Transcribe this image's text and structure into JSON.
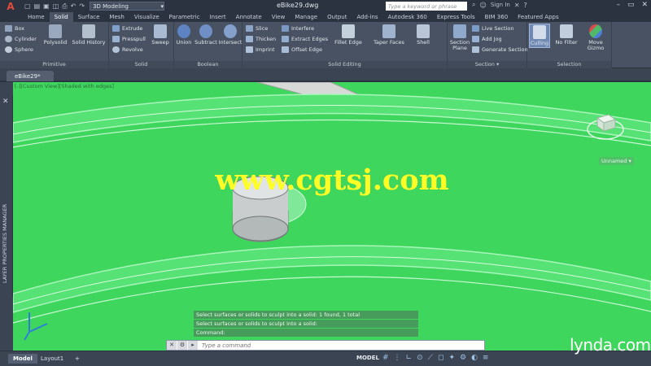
{
  "window": {
    "doc_title": "eBike29.dwg",
    "workspace": "3D Modeling",
    "search_placeholder": "Type a keyword or phrase",
    "sign_in": "Sign In"
  },
  "tabs": [
    "Home",
    "Solid",
    "Surface",
    "Mesh",
    "Visualize",
    "Parametric",
    "Insert",
    "Annotate",
    "View",
    "Manage",
    "Output",
    "Add-ins",
    "Autodesk 360",
    "Express Tools",
    "BIM 360",
    "Featured Apps"
  ],
  "ribbon": {
    "primitive": {
      "title": "Primitive",
      "box": "Box",
      "cylinder": "Cylinder",
      "sphere": "Sphere",
      "polysolid": "Polysolid",
      "solid_history": "Solid History"
    },
    "solid": {
      "title": "Solid",
      "extrude": "Extrude",
      "presspull": "Presspull",
      "revolve": "Revolve",
      "sweep": "Sweep"
    },
    "boolean": {
      "title": "Boolean",
      "union": "Union",
      "subtract": "Subtract",
      "intersect": "Intersect"
    },
    "solid_editing": {
      "title": "Solid Editing",
      "slice": "Slice",
      "thicken": "Thicken",
      "imprint": "Imprint",
      "interfere": "Interfere",
      "extract_edges": "Extract Edges",
      "offset_edge": "Offset Edge",
      "fillet_edge": "Fillet Edge",
      "taper_faces": "Taper Faces",
      "shell": "Shell"
    },
    "section": {
      "title": "Section",
      "section_plane": "Section Plane",
      "live_section": "Live Section",
      "add_jog": "Add Jog",
      "generate_section": "Generate Section"
    },
    "selection": {
      "title": "Selection",
      "culling": "Culling",
      "no_filter": "No Filter",
      "move_gizmo": "Move Gizmo"
    }
  },
  "file_tab": "eBike29*",
  "viewport": {
    "label": "[-][Custom View][Shaded with edges]",
    "watermark": "www.cgtsj.com",
    "unsaved": "Unnamed"
  },
  "palette": {
    "title": "LAYER PROPERTIES MANAGER"
  },
  "command": {
    "history": [
      "Select surfaces or solids to sculpt into a solid: 1 found, 1 total",
      "Select surfaces or solids to sculpt into a solid:",
      "Command:"
    ],
    "placeholder": "Type a command"
  },
  "status": {
    "layouts": [
      "Model",
      "Layout1"
    ],
    "model_label": "MODEL",
    "brand": "lynda.com"
  },
  "colors": {
    "viewport_bg": "#3fd65e",
    "ribbon_bg": "#485262",
    "watermark": "#ffff26",
    "app_accent": "#e34a3c"
  }
}
